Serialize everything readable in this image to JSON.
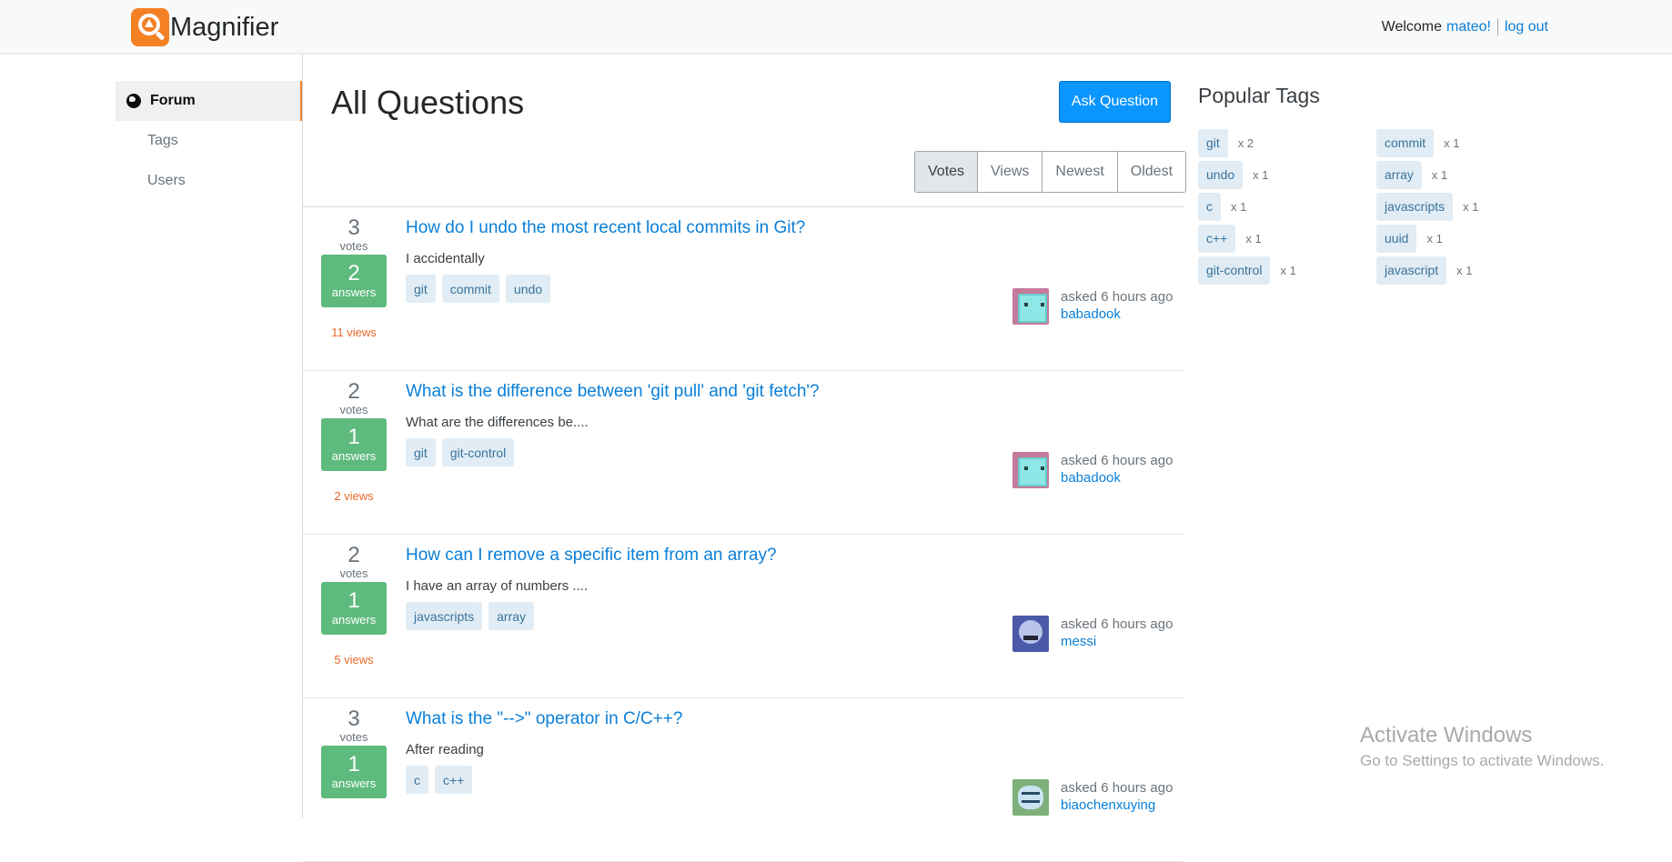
{
  "header": {
    "brand": "Magnifier",
    "welcome": "Welcome",
    "username": "mateo!",
    "logout": "log out"
  },
  "sidebar": {
    "items": [
      {
        "label": "Forum",
        "active": true
      },
      {
        "label": "Tags",
        "active": false
      },
      {
        "label": "Users",
        "active": false
      }
    ]
  },
  "main": {
    "title": "All Questions",
    "ask_button": "Ask Question",
    "filters": [
      "Votes",
      "Views",
      "Newest",
      "Oldest"
    ],
    "active_filter": "Votes",
    "questions": [
      {
        "votes": "3",
        "votes_label": "votes",
        "answers": "2",
        "answers_label": "answers",
        "views": "11 views",
        "title": "How do I undo the most recent local commits in Git?",
        "excerpt": "I accidentally",
        "tags": [
          "git",
          "commit",
          "undo"
        ],
        "asked": "asked 6 hours ago",
        "user": "babadook",
        "avatar": "robot-avatar"
      },
      {
        "votes": "2",
        "votes_label": "votes",
        "answers": "1",
        "answers_label": "answers",
        "views": "2 views",
        "title": "What is the difference between 'git pull' and 'git fetch'?",
        "excerpt": "What are the differences be....",
        "tags": [
          "git",
          "git-control"
        ],
        "asked": "asked 6 hours ago",
        "user": "babadook",
        "avatar": "robot-avatar"
      },
      {
        "votes": "2",
        "votes_label": "votes",
        "answers": "1",
        "answers_label": "answers",
        "views": "5 views",
        "title": "How can I remove a specific item from an array?",
        "excerpt": "I have an array of numbers ....",
        "tags": [
          "javascripts",
          "array"
        ],
        "asked": "asked 6 hours ago",
        "user": "messi",
        "avatar": "monster-avatar"
      },
      {
        "votes": "3",
        "votes_label": "votes",
        "answers": "1",
        "answers_label": "answers",
        "views": "",
        "title": "What is the \"-->\" operator in C/C++?",
        "excerpt": "After reading",
        "tags": [
          "c",
          "c++"
        ],
        "asked": "asked 6 hours ago",
        "user": "biaochenxuying",
        "avatar": "goggles-avatar"
      }
    ]
  },
  "popular_tags": {
    "title": "Popular Tags",
    "tags": [
      {
        "name": "git",
        "count": "x 2"
      },
      {
        "name": "commit",
        "count": "x 1"
      },
      {
        "name": "undo",
        "count": "x 1"
      },
      {
        "name": "array",
        "count": "x 1"
      },
      {
        "name": "c",
        "count": "x 1"
      },
      {
        "name": "javascripts",
        "count": "x 1"
      },
      {
        "name": "c++",
        "count": "x 1"
      },
      {
        "name": "uuid",
        "count": "x 1"
      },
      {
        "name": "git-control",
        "count": "x 1"
      },
      {
        "name": "javascript",
        "count": "x 1"
      }
    ]
  },
  "watermark": {
    "line1": "Activate Windows",
    "line2": "Go to Settings to activate Windows."
  },
  "colors": {
    "accent": "#f48024",
    "link": "#0a7fd8",
    "button": "#0a95ff",
    "answered": "#5eba7d",
    "views": "#e8692a",
    "tag_bg": "#e1ecf4",
    "tag_text": "#39739d"
  }
}
